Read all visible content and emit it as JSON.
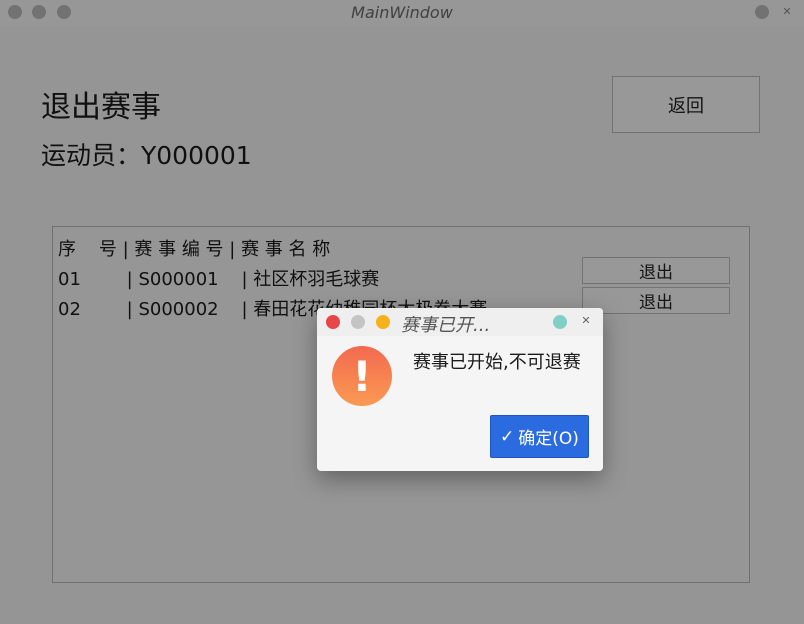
{
  "window": {
    "title": "MainWindow"
  },
  "page": {
    "heading": "退出赛事",
    "athlete_label": "运动员：Y000001",
    "back_button": "返回"
  },
  "table": {
    "header": "序    号 | 赛 事 编 号 | 赛 事 名 称",
    "rows": [
      {
        "text": "01        | S000001    | 社区杯羽毛球赛",
        "action": "退出"
      },
      {
        "text": "02        | S000002    | 春田花花幼稚园杯太极拳大赛",
        "action": "退出"
      }
    ]
  },
  "dialog": {
    "title": "赛事已开...",
    "message": "赛事已开始,不可退赛",
    "ok_button": "确定(O)",
    "icon": "warning-icon",
    "check_glyph": "✓",
    "close_glyph": "✕"
  },
  "colors": {
    "ok_button": "#2b6be0",
    "close_dot": "#e9464a",
    "min_dot": "#c4c4c4",
    "max_dot": "#f5b21b",
    "pin_dot": "#7fcfc6",
    "warning_gradient_top": "#f26a4f",
    "warning_gradient_bottom": "#fb9a52"
  }
}
